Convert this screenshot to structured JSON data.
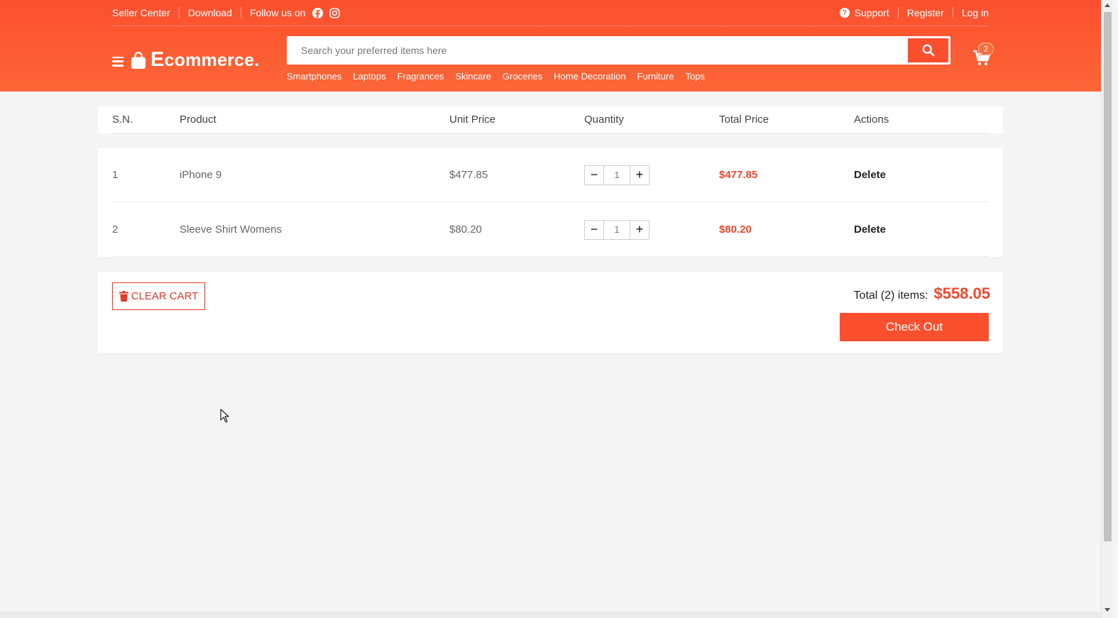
{
  "topbar": {
    "seller_center": "Seller Center",
    "download": "Download",
    "follow_us": "Follow us on",
    "support": "Support",
    "register": "Register",
    "login": "Log in"
  },
  "brand": {
    "first_letter": "E",
    "rest": "commerce."
  },
  "search": {
    "placeholder": "Search your preferred items here"
  },
  "categories": [
    "Smartphones",
    "Laptops",
    "Fragrances",
    "Skincare",
    "Groceries",
    "Home Decoration",
    "Furniture",
    "Tops"
  ],
  "cart": {
    "count": "2"
  },
  "table": {
    "headers": {
      "sn": "S.N.",
      "product": "Product",
      "unit_price": "Unit Price",
      "quantity": "Quantity",
      "total_price": "Total Price",
      "actions": "Actions"
    },
    "rows": [
      {
        "sn": "1",
        "product": "iPhone 9",
        "unit_price": "$477.85",
        "qty": "1",
        "total": "$477.85",
        "action": "Delete",
        "minus": "−",
        "plus": "+"
      },
      {
        "sn": "2",
        "product": "Sleeve Shirt Womens",
        "unit_price": "$80.20",
        "qty": "1",
        "total": "$80.20",
        "action": "Delete",
        "minus": "−",
        "plus": "+"
      }
    ]
  },
  "summary": {
    "clear_cart": "CLEAR CART",
    "total_label": "Total (2) items:",
    "total_amount": "$558.05",
    "checkout": "Check Out"
  },
  "colors": {
    "brand": "#fb4f2e",
    "price_red": "#f0472d",
    "clear_red": "#e23a2c"
  },
  "icons": [
    "hamburger-icon",
    "shopping-bag-icon",
    "facebook-icon",
    "instagram-icon",
    "question-circle-icon",
    "search-icon",
    "cart-icon",
    "trash-icon",
    "mouse-cursor-icon"
  ]
}
